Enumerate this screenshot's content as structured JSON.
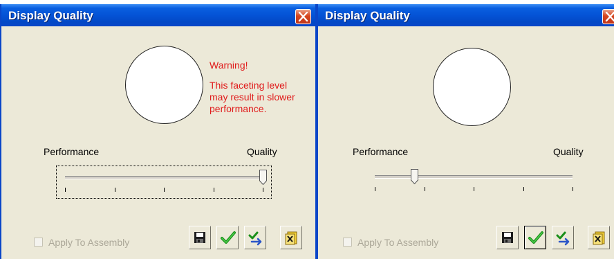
{
  "dialogs": [
    {
      "title": "Display Quality",
      "warning": {
        "heading": "Warning!",
        "message": "This faceting level may result in slower performance."
      },
      "slider": {
        "min_label": "Performance",
        "max_label": "Quality",
        "value": 1.0,
        "ticks": 5
      },
      "checkbox": {
        "label": "Apply To Assembly",
        "checked": false,
        "enabled": false
      },
      "buttons": [
        {
          "icon": "save-icon"
        },
        {
          "icon": "checkmark-icon"
        },
        {
          "icon": "check-arrow-icon"
        },
        {
          "icon": "reset-icon"
        }
      ]
    },
    {
      "title": "Display Quality",
      "slider": {
        "min_label": "Performance",
        "max_label": "Quality",
        "value": 0.2,
        "ticks": 5
      },
      "checkbox": {
        "label": "Apply To Assembly",
        "checked": false,
        "enabled": false
      },
      "buttons": [
        {
          "icon": "save-icon"
        },
        {
          "icon": "checkmark-icon"
        },
        {
          "icon": "check-arrow-icon"
        },
        {
          "icon": "reset-icon"
        }
      ]
    }
  ],
  "colors": {
    "titlebar": "#0453d6",
    "dialog_bg": "#ece9d8",
    "warning_text": "#e01b1b",
    "disabled_text": "#aca899"
  }
}
